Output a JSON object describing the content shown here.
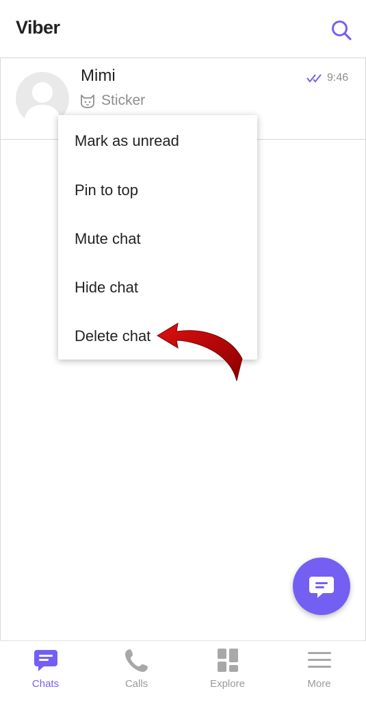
{
  "header": {
    "title": "Viber",
    "search_icon": "search-icon"
  },
  "chat": {
    "name": "Mimi",
    "preview": "Sticker",
    "preview_icon": "sticker-cat-icon",
    "time": "9:46",
    "status_icon": "double-check-icon"
  },
  "context_menu": {
    "items": [
      {
        "label": "Mark as unread"
      },
      {
        "label": "Pin to top"
      },
      {
        "label": "Mute chat"
      },
      {
        "label": "Hide chat"
      },
      {
        "label": "Delete chat"
      }
    ]
  },
  "fab": {
    "icon": "new-chat-icon"
  },
  "bottom_nav": {
    "items": [
      {
        "label": "Chats",
        "icon": "chat-bubble-icon",
        "active": true
      },
      {
        "label": "Calls",
        "icon": "phone-icon",
        "active": false
      },
      {
        "label": "Explore",
        "icon": "grid-icon",
        "active": false
      },
      {
        "label": "More",
        "icon": "hamburger-icon",
        "active": false
      }
    ]
  },
  "colors": {
    "accent": "#7360f2",
    "annotation_arrow": "#c40000",
    "text_primary": "#222222",
    "text_secondary": "#8d8d8d"
  }
}
